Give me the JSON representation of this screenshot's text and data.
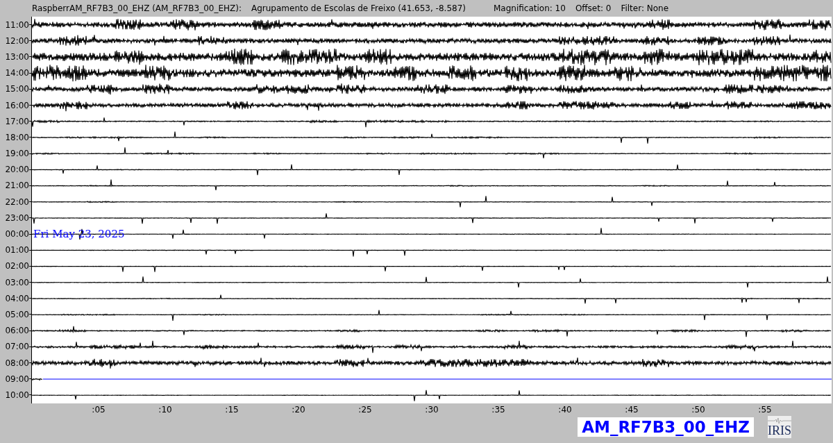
{
  "header": {
    "station": "RaspberrAM_RF7B3_00_EHZ (AM_RF7B3_00_EHZ):",
    "location": "Agrupamento de Escolas de Freixo (41.653, -8.587)",
    "magnification": "Magnification: 10",
    "offset": "Offset: 0",
    "filter": "Filter: None"
  },
  "rows": [
    {
      "hour": "11:00",
      "current": false
    },
    {
      "hour": "12:00",
      "current": false
    },
    {
      "hour": "13:00",
      "current": false
    },
    {
      "hour": "14:00",
      "current": false
    },
    {
      "hour": "15:00",
      "current": false
    },
    {
      "hour": "16:00",
      "current": false
    },
    {
      "hour": "17:00",
      "current": false
    },
    {
      "hour": "18:00",
      "current": false
    },
    {
      "hour": "19:00",
      "current": false
    },
    {
      "hour": "20:00",
      "current": false
    },
    {
      "hour": "21:00",
      "current": false
    },
    {
      "hour": "22:00",
      "current": false
    },
    {
      "hour": "23:00",
      "current": false
    },
    {
      "hour": "00:00",
      "current": false,
      "date": "Fri May 23, 2025"
    },
    {
      "hour": "01:00",
      "current": false
    },
    {
      "hour": "02:00",
      "current": false
    },
    {
      "hour": "03:00",
      "current": false
    },
    {
      "hour": "04:00",
      "current": false
    },
    {
      "hour": "05:00",
      "current": false
    },
    {
      "hour": "06:00",
      "current": false
    },
    {
      "hour": "07:00",
      "current": false
    },
    {
      "hour": "08:00",
      "current": false
    },
    {
      "hour": "09:00",
      "current": true
    },
    {
      "hour": "10:00",
      "current": false
    }
  ],
  "x_ticks": [
    ":05",
    ":10",
    ":15",
    ":20",
    ":25",
    ":30",
    ":35",
    ":40",
    ":45",
    ":50",
    ":55"
  ],
  "channel_label": "AM_RF7B3_00_EHZ",
  "logo": "IRIS"
}
